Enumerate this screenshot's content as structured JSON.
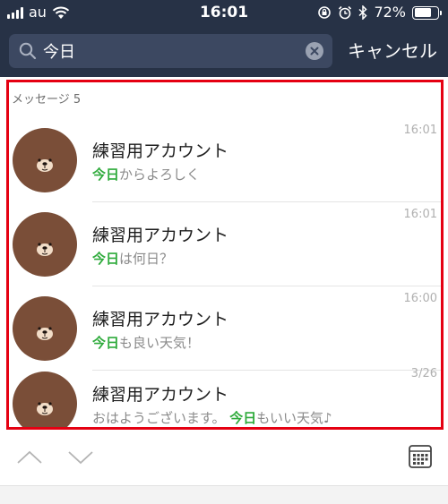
{
  "status_bar": {
    "carrier": "au",
    "time": "16:01",
    "battery_percent": "72%",
    "battery_level": 0.72,
    "icons": [
      "signal-icon",
      "wifi-icon",
      "orientation-lock-icon",
      "alarm-icon",
      "bluetooth-icon",
      "battery-icon"
    ]
  },
  "search": {
    "query": "今日",
    "cancel_label": "キャンセル",
    "icons": [
      "search-icon",
      "clear-icon"
    ]
  },
  "results": {
    "section_label": "メッセージ 5",
    "items": [
      {
        "title": "練習用アカウント",
        "snippet_before": "",
        "highlight": "今日",
        "snippet_after": "からよろしく",
        "time": "16:01"
      },
      {
        "title": "練習用アカウント",
        "snippet_before": "",
        "highlight": "今日",
        "snippet_after": "は何日？",
        "time": "16:01"
      },
      {
        "title": "練習用アカウント",
        "snippet_before": "",
        "highlight": "今日",
        "snippet_after": "も良い天気！",
        "time": "16:00"
      },
      {
        "title": "練習用アカウント",
        "snippet_before": "おはようございます。 ",
        "highlight": "今日",
        "snippet_after": "もいい天気♪",
        "time": "3/26"
      }
    ]
  },
  "toolbar": {
    "icons": [
      "chevron-up-icon",
      "chevron-down-icon",
      "calendar-icon"
    ]
  },
  "colors": {
    "header_bg": "#273246",
    "search_field_bg": "#3c4861",
    "highlight": "#2fab3c",
    "selection_border": "#e50012",
    "avatar_bg": "#7a4e38"
  }
}
